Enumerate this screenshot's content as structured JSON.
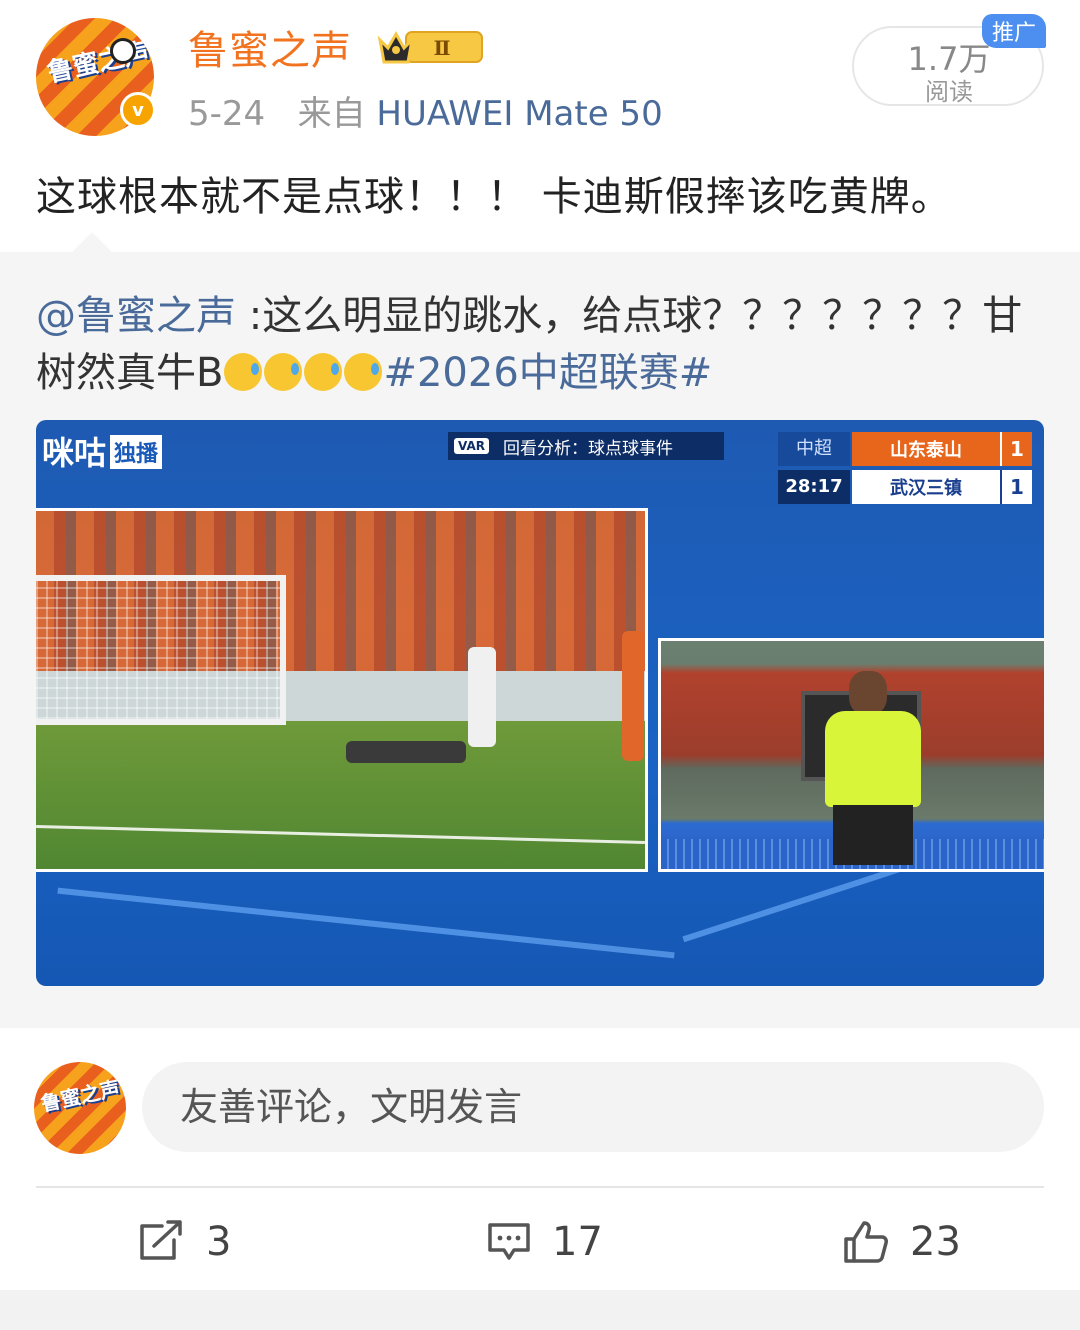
{
  "post": {
    "username": "鲁蜜之声",
    "avatar_text": "鲁蜜之声",
    "verified_icon": "v-badge-icon",
    "verified_label": "v",
    "level_badge": "Ⅱ",
    "date": "5-24",
    "source_prefix": "来自",
    "source_device": "HUAWEI Mate 50",
    "read_count": "1.7万",
    "read_label": "阅读",
    "promo_tag": "推广",
    "text": "这球根本就不是点球！！！ 卡迪斯假摔该吃黄牌。"
  },
  "repost": {
    "mention": "@鲁蜜之声",
    "text": " :这么明显的跳水，给点球？？？？？？？甘树然真牛B",
    "hashtag": "#2026中超联赛#",
    "emoji_name": "sweat-smile-emoji"
  },
  "video": {
    "brand": "咪咕",
    "brand_tag": "独播",
    "var_badge": "VAR",
    "var_text": "回看分析：球点球事件",
    "match_time": "28:17",
    "home_team": "山东泰山",
    "home_score": "1",
    "away_team": "武汉三镇",
    "away_score": "1",
    "league_logo": "中超"
  },
  "comment": {
    "placeholder": "友善评论，文明发言",
    "avatar_text": "鲁蜜之声"
  },
  "actions": {
    "repost_count": "3",
    "comment_count": "17",
    "like_count": "23"
  },
  "colors": {
    "username": "#f2731f",
    "link": "#4a6b9a",
    "promo": "#4c8ff0"
  }
}
